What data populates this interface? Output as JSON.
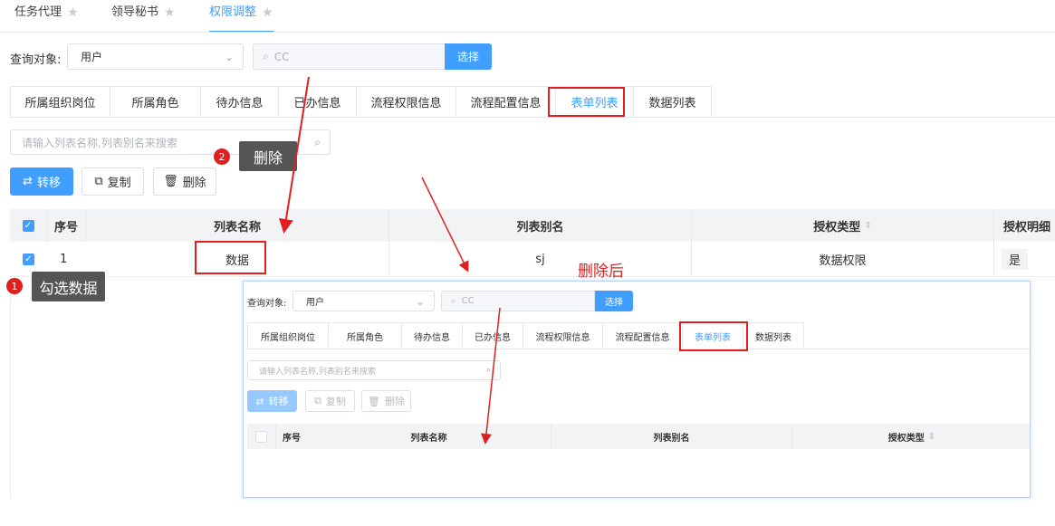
{
  "top_tabs": [
    {
      "label": "任务代理",
      "active": false
    },
    {
      "label": "领导秘书",
      "active": false
    },
    {
      "label": "权限调整",
      "active": true
    }
  ],
  "query": {
    "label": "查询对象:",
    "select_value": "用户",
    "search_placeholder": "CC",
    "select_button": "选择"
  },
  "tabs": [
    "所属组织岗位",
    "所属角色",
    "待办信息",
    "已办信息",
    "流程权限信息",
    "流程配置信息",
    "表单列表",
    "数据列表"
  ],
  "active_tab": "表单列表",
  "list_search_placeholder": "请输入列表名称,列表别名来搜索",
  "actions": {
    "transfer": "转移",
    "copy": "复制",
    "delete": "删除"
  },
  "table": {
    "headers": [
      "序号",
      "列表名称",
      "列表别名",
      "授权类型",
      "授权明细"
    ],
    "rows": [
      {
        "index": "1",
        "name": "数据",
        "alias": "sj",
        "type": "数据权限",
        "detail": "是"
      }
    ]
  },
  "annotations": {
    "step1_label": "勾选数据",
    "step1_num": "1",
    "step2_label": "删除",
    "step2_num": "2",
    "after_delete": "删除后"
  },
  "inner": {
    "query_label": "查询对象:",
    "select_value": "用户",
    "search_placeholder": "CC",
    "select_button": "选择",
    "tabs": [
      "所属组织岗位",
      "所属角色",
      "待办信息",
      "已办信息",
      "流程权限信息",
      "流程配置信息",
      "表单列表",
      "数据列表"
    ],
    "list_search_placeholder": "请输入列表名称,列表别名来搜索",
    "actions": {
      "transfer": "转移",
      "copy": "复制",
      "delete": "删除"
    },
    "headers": [
      "序号",
      "列表名称",
      "列表别名",
      "授权类型"
    ]
  },
  "colors": {
    "accent": "#409eff",
    "annotation": "#e02020",
    "tooltip_bg": "#555555"
  }
}
